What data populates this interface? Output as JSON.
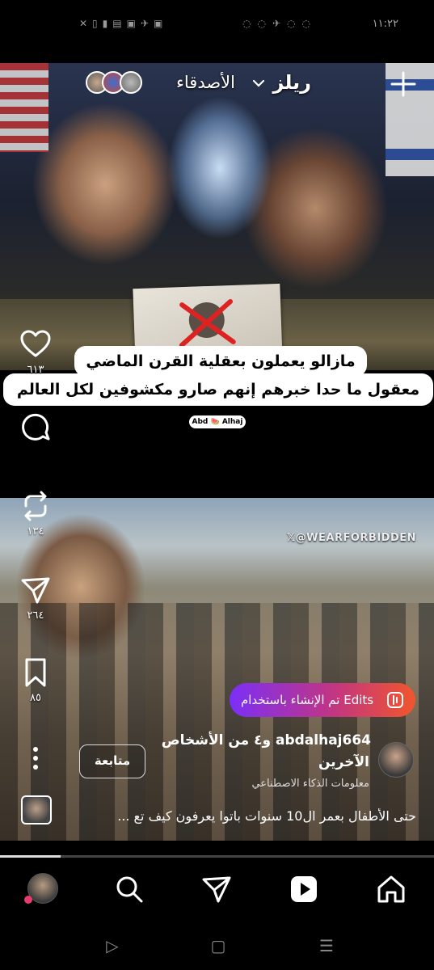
{
  "status_bar": {
    "time": "١١:٢٢",
    "left_icons": "✕▯▮▤▣✈▣",
    "right_icons": "◌◌✈◌◌"
  },
  "header": {
    "title": "ريلز",
    "feed_selector": "الأصدقاء"
  },
  "caption_overlay": {
    "line1": "مازالو يعملون بعقلية القرن الماضي",
    "line2": "معقول ما حدا خبرهم إنهم صارو مكشوفين لكل العالم",
    "brand": "Abd 🍉 Alhaj"
  },
  "video_watermark": "𝕏@WEARFORBIDDEN",
  "actions": {
    "likes": "٦١٣",
    "comments": "",
    "reposts": "١٣٤",
    "shares": "٢٦٤",
    "saves": "٨٥"
  },
  "edits_promo": {
    "label": "تم الإنشاء باستخدام Edits"
  },
  "author": {
    "name_line": "abdalhaj664 و٤ من الأشخاص",
    "name_line2": "الآخرين",
    "follow_label": "متابعة",
    "ai_info": "معلومات الذكاء الاصطناعي",
    "description": "حتى الأطفال بعمر ال10 سنوات باتوا يعرفون كيف تع ..."
  },
  "playback": {
    "progress_fraction": 0.14
  },
  "bottom_nav": {
    "items": [
      "profile",
      "search",
      "messages",
      "reels",
      "home"
    ],
    "active": "reels"
  },
  "colors": {
    "accent_gradient_start": "#7b2ff7",
    "accent_gradient_end": "#f0562b",
    "notification_dot": "#e53c6b"
  }
}
